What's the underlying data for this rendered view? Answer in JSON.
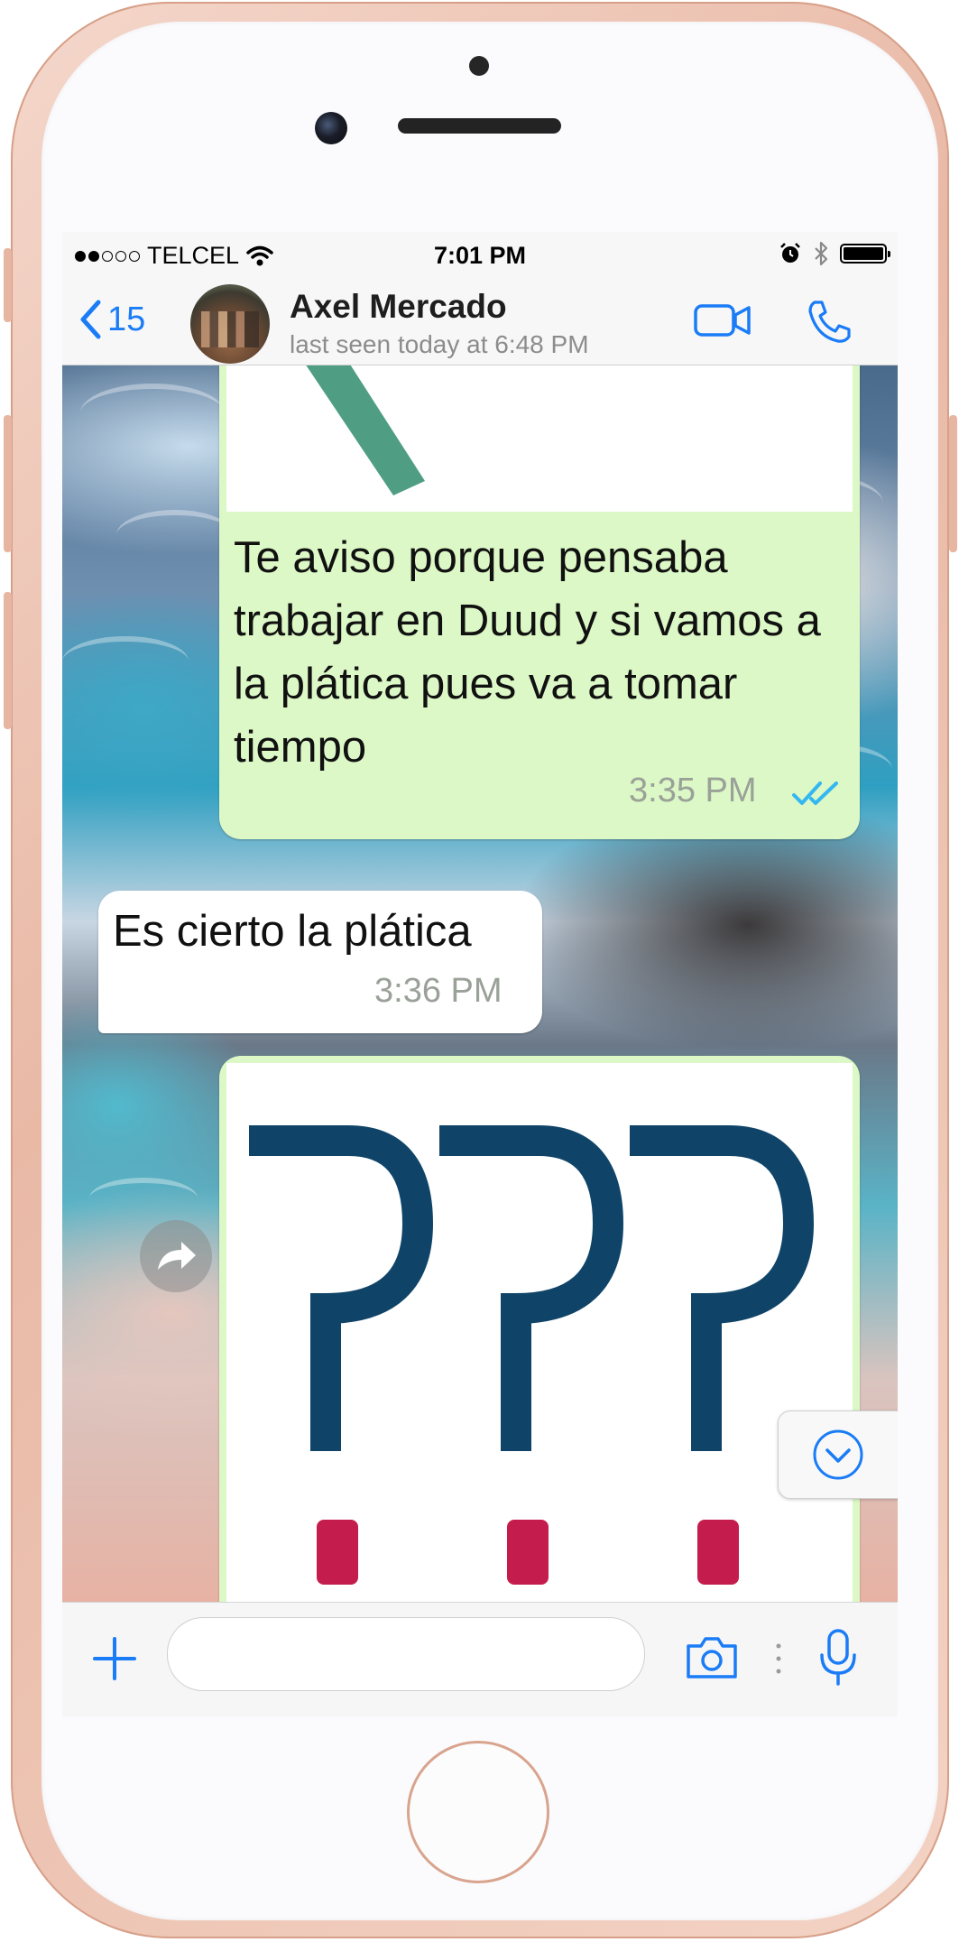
{
  "status_bar": {
    "carrier": "TELCEL",
    "time": "7:01 PM",
    "signal_bars_filled": 2,
    "signal_bars_total": 5,
    "icons": [
      "wifi-icon",
      "alarm-icon",
      "bluetooth-icon",
      "battery-icon"
    ]
  },
  "nav": {
    "back_count": "15",
    "contact_name": "Axel Mercado",
    "contact_status": "last seen today at 6:48 PM",
    "icons": [
      "back-chevron-icon",
      "video-call-icon",
      "phone-icon"
    ]
  },
  "messages": [
    {
      "direction": "outgoing",
      "has_image": true,
      "text": "Te aviso porque pensaba trabajar en Duud y si vamos a la plática pues va a tomar tiempo",
      "time": "3:35 PM",
      "status": "read"
    },
    {
      "direction": "incoming",
      "text": "Es cierto la plática",
      "time": "3:36 PM"
    },
    {
      "direction": "outgoing",
      "has_image": true,
      "image_content": "???"
    }
  ],
  "input": {
    "value": "",
    "placeholder": "",
    "icons": [
      "plus-icon",
      "camera-icon",
      "microphone-icon"
    ]
  },
  "colors": {
    "accent": "#1a7cf6",
    "outgoing_bubble": "#dcf8c6",
    "incoming_bubble": "#ffffff",
    "read_ticks": "#34b7f1",
    "question_mark": "#0f4468",
    "question_dot": "#c41d4d",
    "phone_frame": "#e9b9a6"
  }
}
